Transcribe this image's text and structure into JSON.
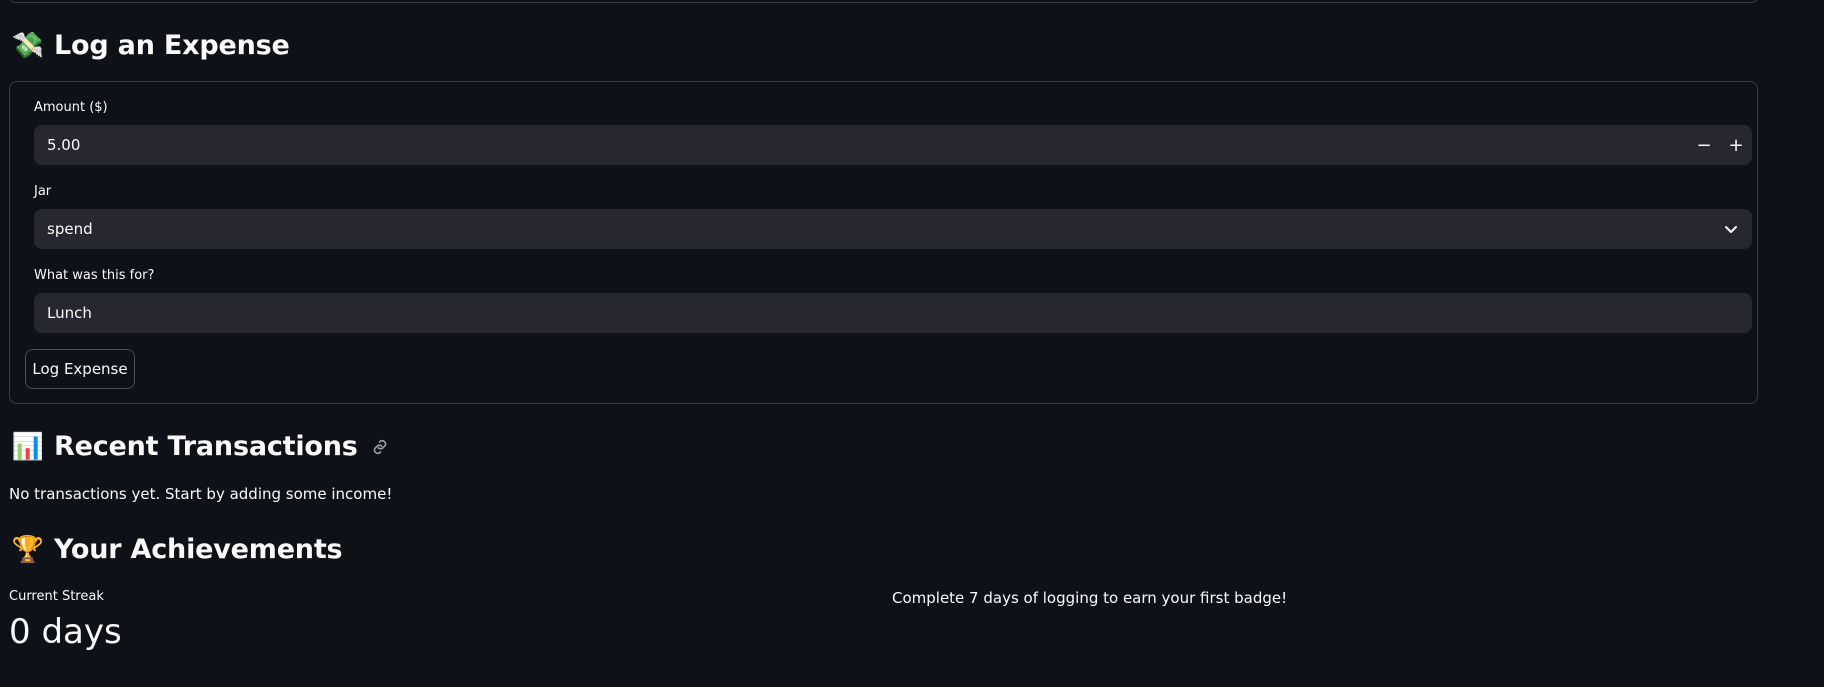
{
  "expense": {
    "icon": "money-with-wings-icon",
    "emoji": "💸",
    "title": "Log an Expense",
    "amount_label": "Amount ($)",
    "amount_value": "5.00",
    "minus": "−",
    "plus": "+",
    "jar_label": "Jar",
    "jar_value": "spend",
    "note_label": "What was this for?",
    "note_value": "Lunch",
    "submit_label": "Log Expense"
  },
  "transactions": {
    "icon": "bar-chart-icon",
    "emoji": "📊",
    "title": "Recent Transactions",
    "empty_message": "No transactions yet. Start by adding some income!"
  },
  "achievements": {
    "icon": "trophy-icon",
    "emoji": "🏆",
    "title": "Your Achievements",
    "streak_label": "Current Streak",
    "streak_value": "0 days",
    "badge_hint": "Complete 7 days of logging to earn your first badge!"
  },
  "colors": {
    "background": "#0e1117",
    "input_bg": "#262730",
    "border": "#3a3d46",
    "text": "#fafafa"
  }
}
